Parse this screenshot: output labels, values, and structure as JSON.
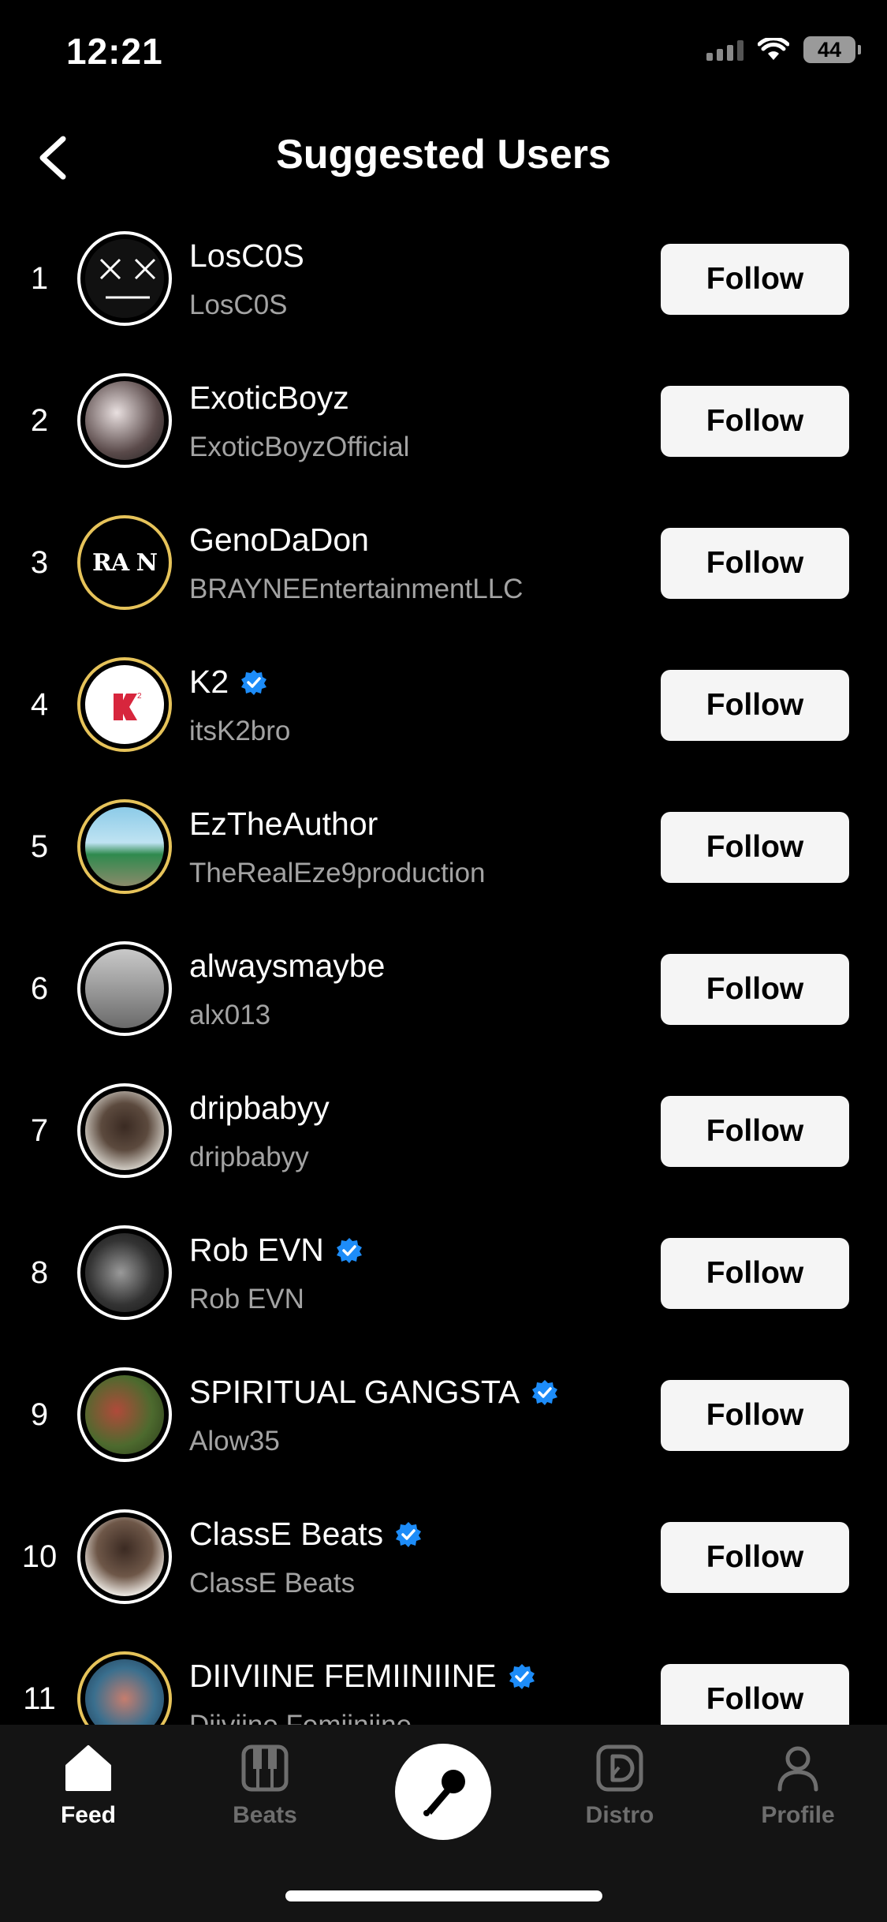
{
  "status_bar": {
    "time": "12:21",
    "battery": "44"
  },
  "header": {
    "title": "Suggested Users"
  },
  "users": [
    {
      "rank": "1",
      "name": "LosC0S",
      "handle": "LosC0S",
      "verified": false,
      "follow_label": "Follow",
      "avatar_ring": "white",
      "avatar_icon": "xx-face-avatar"
    },
    {
      "rank": "2",
      "name": "ExoticBoyz",
      "handle": "ExoticBoyzOfficial",
      "verified": false,
      "follow_label": "Follow",
      "avatar_ring": "white",
      "avatar_icon": "photo-avatar"
    },
    {
      "rank": "3",
      "name": "GenoDaDon",
      "handle": "BRAYNEEntertainmentLLC",
      "verified": false,
      "follow_label": "Follow",
      "avatar_ring": "gold",
      "avatar_icon": "brayne-logo-avatar",
      "avatar_text": "RA N"
    },
    {
      "rank": "4",
      "name": "K2",
      "handle": "itsK2bro",
      "verified": true,
      "follow_label": "Follow",
      "avatar_ring": "gold",
      "avatar_icon": "k2-logo-avatar"
    },
    {
      "rank": "5",
      "name": "EzTheAuthor",
      "handle": "TheRealEze9production",
      "verified": false,
      "follow_label": "Follow",
      "avatar_ring": "gold",
      "avatar_icon": "photo-avatar"
    },
    {
      "rank": "6",
      "name": "alwaysmaybe",
      "handle": "alx013",
      "verified": false,
      "follow_label": "Follow",
      "avatar_ring": "white",
      "avatar_icon": "photo-avatar"
    },
    {
      "rank": "7",
      "name": "dripbabyy",
      "handle": "dripbabyy",
      "verified": false,
      "follow_label": "Follow",
      "avatar_ring": "white",
      "avatar_icon": "photo-avatar"
    },
    {
      "rank": "8",
      "name": "Rob EVN",
      "handle": "Rob EVN",
      "verified": true,
      "follow_label": "Follow",
      "avatar_ring": "white",
      "avatar_icon": "photo-avatar"
    },
    {
      "rank": "9",
      "name": "SPIRITUAL GANGSTA ",
      "handle": "Alow35",
      "verified": true,
      "follow_label": "Follow",
      "avatar_ring": "white",
      "avatar_icon": "photo-avatar"
    },
    {
      "rank": "10",
      "name": "ClassE Beats",
      "handle": "ClassE Beats",
      "verified": true,
      "follow_label": "Follow",
      "avatar_ring": "white",
      "avatar_icon": "photo-avatar"
    },
    {
      "rank": "11",
      "name": "DIIVIINE FEMIINIINE",
      "handle": "Diiviine Femiiniine",
      "verified": true,
      "follow_label": "Follow",
      "avatar_ring": "gold",
      "avatar_icon": "photo-avatar"
    }
  ],
  "tab_bar": {
    "tabs": [
      {
        "label": "Feed",
        "icon": "home-icon",
        "active": true
      },
      {
        "label": "Beats",
        "icon": "piano-icon",
        "active": false
      },
      {
        "label": "",
        "icon": "microphone-icon",
        "active": false
      },
      {
        "label": "Distro",
        "icon": "distro-icon",
        "active": false
      },
      {
        "label": "Profile",
        "icon": "person-icon",
        "active": false
      }
    ]
  },
  "colors": {
    "background": "#000000",
    "tab_bar": "#141414",
    "verified": "#1d8cf8",
    "gold_ring": "#e6c35a",
    "muted_text": "#a3a3a3",
    "button_bg": "#f5f5f5"
  }
}
